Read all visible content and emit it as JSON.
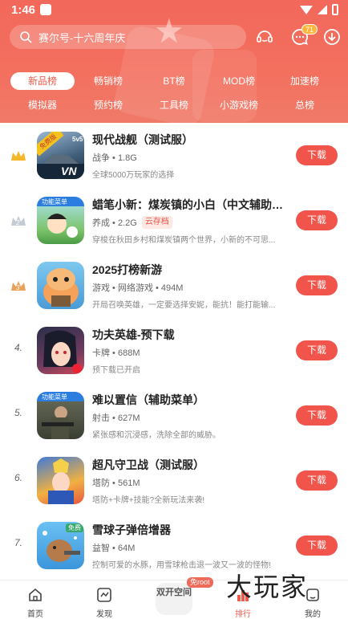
{
  "status": {
    "time": "1:46"
  },
  "search": {
    "text": "赛尔号-十六周年庆"
  },
  "header": {
    "message_badge": "71"
  },
  "tabs": [
    {
      "label": "新品榜",
      "active": true
    },
    {
      "label": "畅销榜"
    },
    {
      "label": "BT榜"
    },
    {
      "label": "MOD榜"
    },
    {
      "label": "加速榜"
    },
    {
      "label": "模拟器"
    },
    {
      "label": "预约榜"
    },
    {
      "label": "工具榜"
    },
    {
      "label": "小游戏榜"
    },
    {
      "label": "总榜"
    }
  ],
  "list": [
    {
      "rank": "1",
      "title": "现代战舰（测试服）",
      "meta": "战争 • 1.8G",
      "tag": "",
      "desc": "全球5000万玩家的选择",
      "button": "下载",
      "icon_badge": "5v5",
      "icon_label": "免费版"
    },
    {
      "rank": "2",
      "title": "蜡笔小新：煤炭镇的小白（中文辅助菜...",
      "meta": "养成 • 2.2G",
      "tag": "云存档",
      "desc": "穿梭在秋田乡村和煤炭镇两个世界，小新的不可思...",
      "button": "下载",
      "icon_label": "功能菜单"
    },
    {
      "rank": "3",
      "title": "2025打榜新游",
      "meta": "游戏 • 网络游戏 • 494M",
      "tag": "",
      "desc": "开局召唤英雄，一定要选择安妮，能抗！能打能输...",
      "button": "下载"
    },
    {
      "rank": "4.",
      "title": "功夫英雄-预下载",
      "meta": "卡牌 • 688M",
      "tag": "",
      "desc": "预下载已开启",
      "button": "下载"
    },
    {
      "rank": "5.",
      "title": "难以置信（辅助菜单）",
      "meta": "射击 • 627M",
      "tag": "",
      "desc": "紧张感和沉浸感，洗除全部的威胁。",
      "button": "下载",
      "icon_label": "功能菜单"
    },
    {
      "rank": "6.",
      "title": "超凡守卫战（测试服）",
      "meta": "塔防 • 561M",
      "tag": "",
      "desc": "塔防+卡牌+技能?全新玩法来袭!",
      "button": "下载"
    },
    {
      "rank": "7.",
      "title": "雪球子弹倍增器",
      "meta": "益智 • 64M",
      "tag": "",
      "desc": "控制可爱的水豚，用雪球枪击退一波又一波的怪物!",
      "button": "下载",
      "icon_label": "免费"
    }
  ],
  "bottom": {
    "items": [
      {
        "label": "首页"
      },
      {
        "label": "发现"
      },
      {
        "label": "排行",
        "active": true
      },
      {
        "label": "我的"
      }
    ],
    "center_label": "双开空间",
    "center_badge": "免root",
    "watermark": "大玩家"
  },
  "colors": {
    "accent": "#f0544a",
    "header": "#f2685a"
  }
}
